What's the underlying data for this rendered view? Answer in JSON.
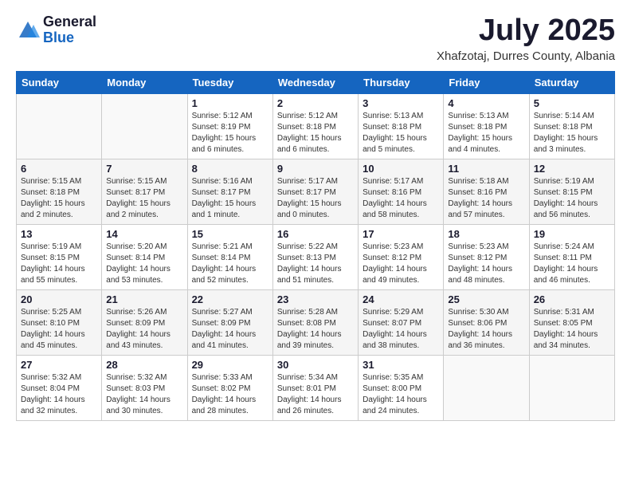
{
  "logo": {
    "general": "General",
    "blue": "Blue"
  },
  "header": {
    "month": "July 2025",
    "location": "Xhafzotaj, Durres County, Albania"
  },
  "days_of_week": [
    "Sunday",
    "Monday",
    "Tuesday",
    "Wednesday",
    "Thursday",
    "Friday",
    "Saturday"
  ],
  "weeks": [
    [
      {
        "day": "",
        "info": ""
      },
      {
        "day": "",
        "info": ""
      },
      {
        "day": "1",
        "info": "Sunrise: 5:12 AM\nSunset: 8:19 PM\nDaylight: 15 hours and 6 minutes."
      },
      {
        "day": "2",
        "info": "Sunrise: 5:12 AM\nSunset: 8:18 PM\nDaylight: 15 hours and 6 minutes."
      },
      {
        "day": "3",
        "info": "Sunrise: 5:13 AM\nSunset: 8:18 PM\nDaylight: 15 hours and 5 minutes."
      },
      {
        "day": "4",
        "info": "Sunrise: 5:13 AM\nSunset: 8:18 PM\nDaylight: 15 hours and 4 minutes."
      },
      {
        "day": "5",
        "info": "Sunrise: 5:14 AM\nSunset: 8:18 PM\nDaylight: 15 hours and 3 minutes."
      }
    ],
    [
      {
        "day": "6",
        "info": "Sunrise: 5:15 AM\nSunset: 8:18 PM\nDaylight: 15 hours and 2 minutes."
      },
      {
        "day": "7",
        "info": "Sunrise: 5:15 AM\nSunset: 8:17 PM\nDaylight: 15 hours and 2 minutes."
      },
      {
        "day": "8",
        "info": "Sunrise: 5:16 AM\nSunset: 8:17 PM\nDaylight: 15 hours and 1 minute."
      },
      {
        "day": "9",
        "info": "Sunrise: 5:17 AM\nSunset: 8:17 PM\nDaylight: 15 hours and 0 minutes."
      },
      {
        "day": "10",
        "info": "Sunrise: 5:17 AM\nSunset: 8:16 PM\nDaylight: 14 hours and 58 minutes."
      },
      {
        "day": "11",
        "info": "Sunrise: 5:18 AM\nSunset: 8:16 PM\nDaylight: 14 hours and 57 minutes."
      },
      {
        "day": "12",
        "info": "Sunrise: 5:19 AM\nSunset: 8:15 PM\nDaylight: 14 hours and 56 minutes."
      }
    ],
    [
      {
        "day": "13",
        "info": "Sunrise: 5:19 AM\nSunset: 8:15 PM\nDaylight: 14 hours and 55 minutes."
      },
      {
        "day": "14",
        "info": "Sunrise: 5:20 AM\nSunset: 8:14 PM\nDaylight: 14 hours and 53 minutes."
      },
      {
        "day": "15",
        "info": "Sunrise: 5:21 AM\nSunset: 8:14 PM\nDaylight: 14 hours and 52 minutes."
      },
      {
        "day": "16",
        "info": "Sunrise: 5:22 AM\nSunset: 8:13 PM\nDaylight: 14 hours and 51 minutes."
      },
      {
        "day": "17",
        "info": "Sunrise: 5:23 AM\nSunset: 8:12 PM\nDaylight: 14 hours and 49 minutes."
      },
      {
        "day": "18",
        "info": "Sunrise: 5:23 AM\nSunset: 8:12 PM\nDaylight: 14 hours and 48 minutes."
      },
      {
        "day": "19",
        "info": "Sunrise: 5:24 AM\nSunset: 8:11 PM\nDaylight: 14 hours and 46 minutes."
      }
    ],
    [
      {
        "day": "20",
        "info": "Sunrise: 5:25 AM\nSunset: 8:10 PM\nDaylight: 14 hours and 45 minutes."
      },
      {
        "day": "21",
        "info": "Sunrise: 5:26 AM\nSunset: 8:09 PM\nDaylight: 14 hours and 43 minutes."
      },
      {
        "day": "22",
        "info": "Sunrise: 5:27 AM\nSunset: 8:09 PM\nDaylight: 14 hours and 41 minutes."
      },
      {
        "day": "23",
        "info": "Sunrise: 5:28 AM\nSunset: 8:08 PM\nDaylight: 14 hours and 39 minutes."
      },
      {
        "day": "24",
        "info": "Sunrise: 5:29 AM\nSunset: 8:07 PM\nDaylight: 14 hours and 38 minutes."
      },
      {
        "day": "25",
        "info": "Sunrise: 5:30 AM\nSunset: 8:06 PM\nDaylight: 14 hours and 36 minutes."
      },
      {
        "day": "26",
        "info": "Sunrise: 5:31 AM\nSunset: 8:05 PM\nDaylight: 14 hours and 34 minutes."
      }
    ],
    [
      {
        "day": "27",
        "info": "Sunrise: 5:32 AM\nSunset: 8:04 PM\nDaylight: 14 hours and 32 minutes."
      },
      {
        "day": "28",
        "info": "Sunrise: 5:32 AM\nSunset: 8:03 PM\nDaylight: 14 hours and 30 minutes."
      },
      {
        "day": "29",
        "info": "Sunrise: 5:33 AM\nSunset: 8:02 PM\nDaylight: 14 hours and 28 minutes."
      },
      {
        "day": "30",
        "info": "Sunrise: 5:34 AM\nSunset: 8:01 PM\nDaylight: 14 hours and 26 minutes."
      },
      {
        "day": "31",
        "info": "Sunrise: 5:35 AM\nSunset: 8:00 PM\nDaylight: 14 hours and 24 minutes."
      },
      {
        "day": "",
        "info": ""
      },
      {
        "day": "",
        "info": ""
      }
    ]
  ]
}
